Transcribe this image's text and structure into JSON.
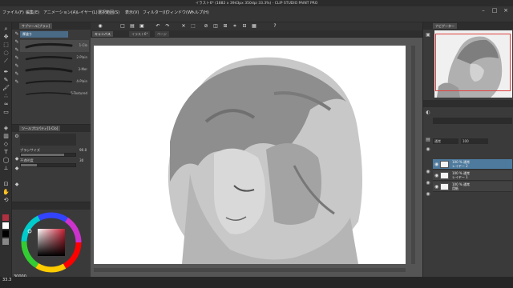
{
  "app": {
    "window_title": "イラスト6* (1882 x 3943px 350dpi 33.3%) - CLIP STUDIO PAINT PRO"
  },
  "menu": {
    "items": [
      "ファイル(F)",
      "編集(E)",
      "アニメーション(A)",
      "レイヤー(L)",
      "選択範囲(S)",
      "表示(V)",
      "フィルター(I)",
      "ウィンドウ(W)",
      "ヘルプ(H)"
    ],
    "window_buttons": [
      "–",
      "□",
      "×"
    ]
  },
  "subtool_panel": {
    "header_tab": "サブツール[ブラシ]",
    "group_tab": "厚塗り",
    "brushes": [
      {
        "label": "1-Clo"
      },
      {
        "label": "2-Plain"
      },
      {
        "label": "3-Mer"
      },
      {
        "label": "4-Plain"
      },
      {
        "label": "5-Textured"
      }
    ]
  },
  "tool_property": {
    "header_tab": "ツールプロパティ[1-Clo]",
    "props": [
      {
        "label": "ブラシサイズ",
        "value": "90.0",
        "level": 0.8
      },
      {
        "label": "不透明度",
        "value": "30",
        "level": 0.3
      }
    ]
  },
  "color_panel": {
    "value_display": "30000"
  },
  "navigator": {
    "header_tab": "ナビゲーター"
  },
  "layer_panel": {
    "blend_mode": "通常",
    "opacity_label": "100",
    "layers": [
      {
        "pct": "100 % 通常",
        "name": "レイヤー 2",
        "selected": true
      },
      {
        "pct": "100 % 通常",
        "name": "レイヤー 1",
        "selected": false
      },
      {
        "pct": "100 % 通常",
        "name": "用紙",
        "selected": false
      }
    ]
  },
  "subtool_tabs": {
    "items": [
      "キャンバス",
      "イラスト6*",
      "ページ"
    ]
  },
  "status": {
    "zoom": "33.3"
  },
  "colors": {
    "selected_layer": "#4e7a9e",
    "navigator_frame": "#e04040",
    "main_color": "#b03040"
  },
  "icons": {
    "toolbar": [
      "zoom-icon",
      "move-icon",
      "select-icon",
      "lasso-icon",
      "eyedropper-icon",
      "pen-icon",
      "pencil-icon",
      "brush-icon",
      "airbrush-icon",
      "blend-icon",
      "eraser-icon",
      "fill-icon",
      "gradient-icon",
      "figure-icon",
      "text-icon",
      "balloon-icon",
      "ruler-icon"
    ]
  }
}
